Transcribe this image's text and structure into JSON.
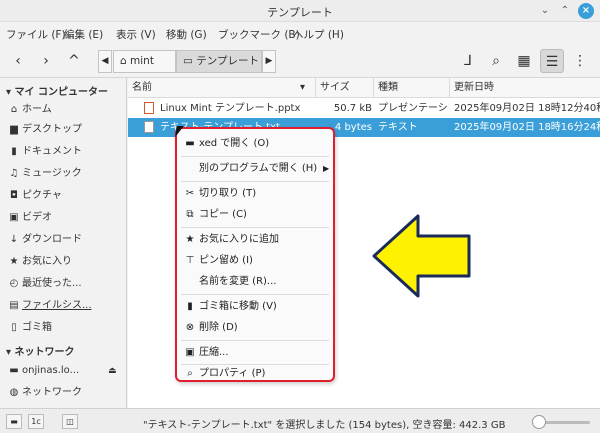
{
  "window": {
    "title": "テンプレート"
  },
  "menubar": [
    "ファイル (F)",
    "編集 (E)",
    "表示 (V)",
    "移動 (G)",
    "ブックマーク (B)",
    "ヘルプ (H)"
  ],
  "breadcrumbs": [
    "mint",
    "テンプレート"
  ],
  "sidebar": {
    "sections": [
      {
        "title": "マイ コンピューター",
        "items": [
          {
            "label": "ホーム",
            "icon": "home-icon"
          },
          {
            "label": "デスクトップ",
            "icon": "desktop-icon"
          },
          {
            "label": "ドキュメント",
            "icon": "document-icon"
          },
          {
            "label": "ミュージック",
            "icon": "music-icon"
          },
          {
            "label": "ピクチャ",
            "icon": "camera-icon"
          },
          {
            "label": "ビデオ",
            "icon": "video-icon"
          },
          {
            "label": "ダウンロード",
            "icon": "download-icon"
          },
          {
            "label": "お気に入り",
            "icon": "star-icon"
          },
          {
            "label": "最近使った...",
            "icon": "recent-icon"
          },
          {
            "label": "ファイルシス...",
            "icon": "drive-icon"
          },
          {
            "label": "ゴミ箱",
            "icon": "trash-icon"
          }
        ]
      },
      {
        "title": "ネットワーク",
        "items": [
          {
            "label": "onjinas.lo...",
            "icon": "folder-icon"
          },
          {
            "label": "ネットワーク",
            "icon": "network-icon"
          }
        ]
      }
    ]
  },
  "columns": [
    "名前",
    "サイズ",
    "種類",
    "更新日時"
  ],
  "files": [
    {
      "name": "Linux Mint テンプレート.pptx",
      "size": "50.7 kB",
      "type": "プレゼンテーション",
      "modified": "2025年09月02日 18時12分40秒",
      "selected": false
    },
    {
      "name": "テキスト-テンプレート.txt",
      "size": "4 bytes",
      "type": "テキスト",
      "modified": "2025年09月02日 18時16分24秒",
      "selected": true
    }
  ],
  "context_menu": [
    {
      "label": "xed で開く (O)",
      "icon": "folder-open-icon"
    },
    {
      "separator": true
    },
    {
      "label": "別のプログラムで開く (H)",
      "icon": "",
      "submenu": true
    },
    {
      "separator": true
    },
    {
      "label": "切り取り (T)",
      "icon": "cut-icon"
    },
    {
      "label": "コピー (C)",
      "icon": "copy-icon"
    },
    {
      "separator": true
    },
    {
      "label": "お気に入りに追加",
      "icon": "star-icon"
    },
    {
      "label": "ピン留め (I)",
      "icon": "pin-icon"
    },
    {
      "label": "名前を変更 (R)...",
      "icon": ""
    },
    {
      "separator": true
    },
    {
      "label": "ゴミ箱に移動 (V)",
      "icon": "trash-icon"
    },
    {
      "label": "削除 (D)",
      "icon": "delete-icon"
    },
    {
      "separator": true
    },
    {
      "label": "圧縮...",
      "icon": "archive-icon"
    },
    {
      "separator": true
    },
    {
      "label": "プロパティ (P)",
      "icon": "properties-icon"
    }
  ],
  "status": {
    "text": "\"テキスト-テンプレート.txt\" を選択しました (154 bytes), 空き容量: 442.3 GB"
  },
  "colors": {
    "selection": "#3a9fd8",
    "highlight_border": "#e01e2e",
    "arrow_fill": "#fff200"
  }
}
